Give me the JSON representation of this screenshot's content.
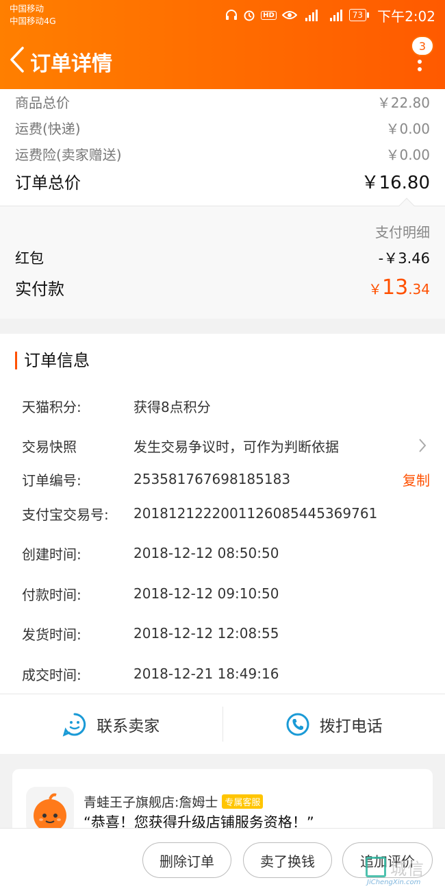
{
  "status_bar": {
    "carrier1": "中国移动",
    "carrier2": "中国移动4G",
    "battery": "73",
    "time": "下午2:02",
    "hd": "HD"
  },
  "nav": {
    "title": "订单详情",
    "badge": "3"
  },
  "prices": {
    "goods_total_label": "商品总价",
    "goods_total_value": "￥22.80",
    "shipping_label": "运费(快递)",
    "shipping_value": "￥0.00",
    "insurance_label": "运费险(卖家赠送)",
    "insurance_value": "￥0.00",
    "order_total_label": "订单总价",
    "order_total_value": "￥16.80"
  },
  "payment": {
    "detail_label": "支付明细",
    "redpacket_label": "红包",
    "redpacket_value": "-￥3.46",
    "paid_label": "实付款",
    "paid_currency": "￥",
    "paid_int": "13",
    "paid_dec": ".34"
  },
  "order_info": {
    "title": "订单信息",
    "rows": [
      {
        "label": "天猫积分:",
        "value": "获得8点积分"
      },
      {
        "label": "交易快照",
        "value": "发生交易争议时，可作为判断依据"
      },
      {
        "label": "订单编号:",
        "value": "253581767698185183"
      },
      {
        "label": "支付宝交易号:",
        "value": "2018121222001126085445369761"
      },
      {
        "label": "创建时间:",
        "value": "2018-12-12 08:50:50"
      },
      {
        "label": "付款时间:",
        "value": "2018-12-12 09:10:50"
      },
      {
        "label": "发货时间:",
        "value": "2018-12-12 12:08:55"
      },
      {
        "label": "成交时间:",
        "value": "2018-12-21 18:49:16"
      }
    ],
    "copy_label": "复制"
  },
  "contact": {
    "seller_label": "联系卖家",
    "phone_label": "拨打电话"
  },
  "chat": {
    "shop_name": "青蛙王子旗舰店:詹姆士",
    "tag": "专属客服",
    "message": "“恭喜！您获得升级店铺服务资格！”"
  },
  "bottom": {
    "delete_label": "删除订单",
    "sell_label": "卖了换钱",
    "review_label": "追加评价"
  },
  "watermark": {
    "text": "城信",
    "sub": "JiChengXin.com"
  },
  "colors": {
    "accent": "#ff5000",
    "header_start": "#ff7f00",
    "header_end": "#ff5a00",
    "icon_blue": "#1a9ad6"
  }
}
